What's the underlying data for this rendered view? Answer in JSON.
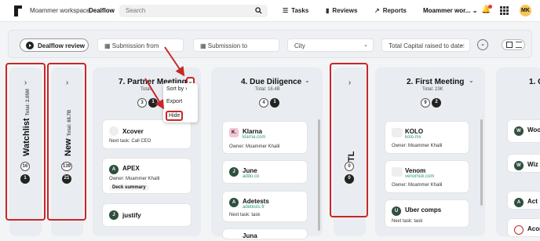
{
  "header": {
    "workspace": "Moammer workspace",
    "app_name": "Dealflow",
    "search_placeholder": "Search",
    "nav": {
      "tasks": "Tasks",
      "reviews": "Reviews",
      "reports": "Reports"
    },
    "workspace_dropdown": "Moammer wor...",
    "avatar_initials": "MK"
  },
  "filters": {
    "pipeline_review": "Dealflow review",
    "submission_from": "Submission from",
    "submission_to": "Submission to",
    "city": "City",
    "total_capital": "Total Capital raised to date:"
  },
  "columns": {
    "watchlist": {
      "name": "Watchlist",
      "total": "Total: 2.05M",
      "count_a": "16",
      "count_b": "1"
    },
    "new": {
      "name": "New",
      "total": "Total: 68.7B",
      "count_a": "139",
      "count_b": "21"
    },
    "partner_meeting": {
      "title": "7. Partner Meeting",
      "total": "Total:",
      "count_a": "3",
      "count_b": "1",
      "menu": {
        "sort_by": "Sort by",
        "export": "Export",
        "hide": "Hide"
      },
      "cards": [
        {
          "initial": "",
          "name": "Xcover",
          "line1": "Next task: Call CEO"
        },
        {
          "initial": "A",
          "name": "APEX",
          "line1": "Owner: Moammer Khalil",
          "pill": "Deck summary"
        },
        {
          "initial": "J",
          "name": "justify"
        }
      ]
    },
    "due_diligence": {
      "title": "4. Due Diligence",
      "total": "Total: 16.4B",
      "count_a": "4",
      "count_b": "1",
      "cards": [
        {
          "initial": "K.",
          "name": "Klarna",
          "site": "klarna.com",
          "line1": "Owner: Moammer Khalil"
        },
        {
          "initial": "J",
          "name": "June",
          "site": "addo.co"
        },
        {
          "initial": "A",
          "name": "Adetests",
          "site": "adetests.fr",
          "line1": "Next task: task"
        },
        {
          "initial": "",
          "name": "Juna"
        }
      ]
    },
    "tl": {
      "name": "TL",
      "count_a": "0",
      "count_b": "0"
    },
    "first_meeting": {
      "title": "2. First Meeting",
      "total": "Total: 23K",
      "count_a": "9",
      "count_b": "2",
      "cards": [
        {
          "initial": "",
          "name": "KOLO",
          "site": "kolo.mx",
          "line1": "Owner: Moammer Khalil"
        },
        {
          "initial": "",
          "name": "Venom",
          "site": "venomuk.com",
          "line1": "Owner: Moammer Khalil"
        },
        {
          "initial": "U",
          "name": "Uber comps",
          "line1": "Next task: task"
        }
      ]
    },
    "next_partial": {
      "title": "1. C",
      "cards": [
        {
          "initial": "W",
          "name": "Wood"
        },
        {
          "initial": "W",
          "name": "Wiz"
        },
        {
          "initial": "A",
          "name": "Act"
        },
        {
          "initial": "",
          "name": "Acorn"
        }
      ]
    }
  },
  "colors": {
    "highlight": "#c62828",
    "accent_green": "#2a9d6c",
    "avatar_bg": "#f6c65a"
  }
}
